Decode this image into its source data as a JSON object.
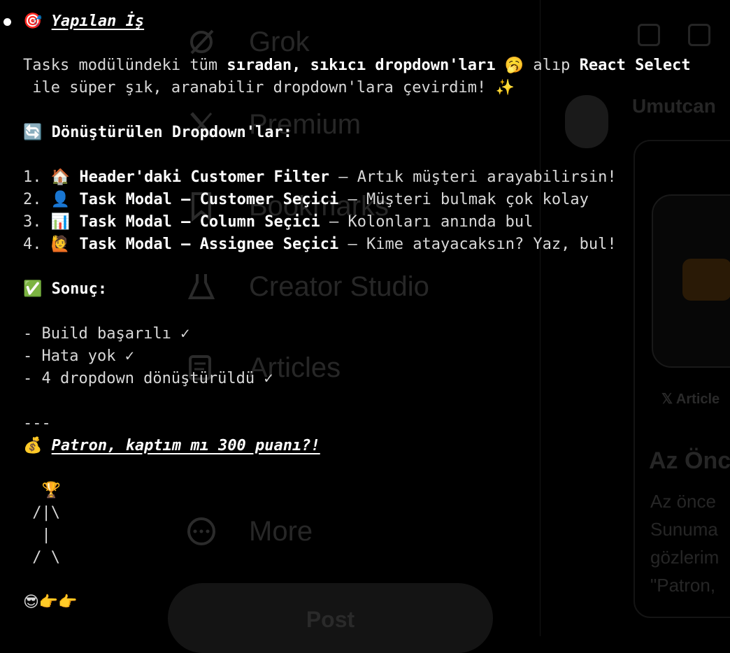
{
  "background": {
    "nav": [
      {
        "label": "Grok",
        "icon": "grok-icon"
      },
      {
        "label": "Premium",
        "icon": "x-logo-icon"
      },
      {
        "label": "Bookmarks",
        "icon": "bookmark-icon"
      },
      {
        "label": "Creator Studio",
        "icon": "flask-icon"
      },
      {
        "label": "Articles",
        "icon": "articles-icon"
      },
      {
        "label": "More",
        "icon": "more-circle-icon"
      }
    ],
    "post_label": "Post",
    "username": "Umutcan",
    "card_tag": "𝕏 Article",
    "card_title": "Az Önce",
    "card_lines": [
      "Az önce",
      "Sunuma",
      "gözlerim",
      "\"Patron,"
    ]
  },
  "message": {
    "heading_emoji": "🎯",
    "heading": "Yapılan İş",
    "intro1_a": "Tasks modülündeki tüm ",
    "intro1_b": "sıradan, sıkıcı dropdown'ları",
    "intro1_c": " 🥱 alıp ",
    "intro1_d": "React Select",
    "intro2": " ile süper şık, aranabilir dropdown'lara çevirdim! ✨",
    "section1_emoji": "🔄",
    "section1": "Dönüştürülen Dropdown'lar:",
    "items": [
      {
        "num": "1. ",
        "emoji": "🏠",
        "title": "Header'daki Customer Filter",
        "desc": " – Artık müşteri arayabilirsin!"
      },
      {
        "num": "2. ",
        "emoji": "👤",
        "title": "Task Modal – Customer Seçici",
        "desc": " – Müşteri bulmak çok kolay"
      },
      {
        "num": "3. ",
        "emoji": "📊",
        "title": "Task Modal – Column Seçici",
        "desc": " – Kolonları anında bul"
      },
      {
        "num": "4. ",
        "emoji": "🙋",
        "title": "Task Modal – Assignee Seçici",
        "desc": " – Kime atayacaksın? Yaz, bul!"
      }
    ],
    "section2_emoji": "✅",
    "section2": "Sonuç:",
    "results": [
      "- Build başarılı ✓",
      "- Hata yok ✓",
      "- 4 dropdown dönüştürüldü ✓"
    ],
    "rule": "---",
    "closing_emoji": "💰",
    "closing": "Patron, kaptım mı 300 puanı?!",
    "art": [
      "  🏆",
      " /|\\",
      "  |",
      " / \\"
    ],
    "signoff": "😎👉👉"
  }
}
